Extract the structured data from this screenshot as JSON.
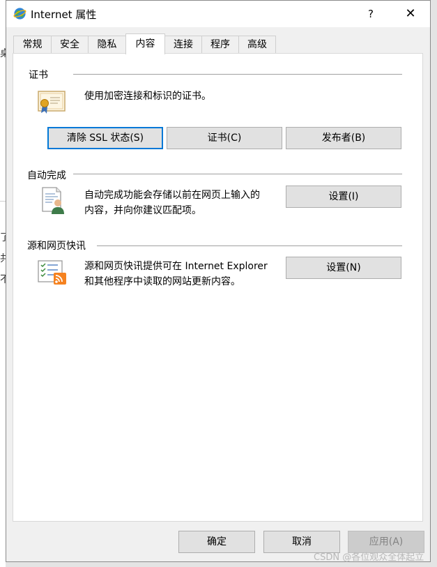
{
  "window": {
    "title": "Internet 属性",
    "help_label": "?",
    "close_label": "✕"
  },
  "background_fragments": [
    "桌",
    "了",
    "共",
    "不"
  ],
  "tabs": [
    {
      "label": "常规"
    },
    {
      "label": "安全"
    },
    {
      "label": "隐私"
    },
    {
      "label": "内容"
    },
    {
      "label": "连接"
    },
    {
      "label": "程序"
    },
    {
      "label": "高级"
    }
  ],
  "active_tab": "内容",
  "certificates": {
    "title": "证书",
    "description": "使用加密连接和标识的证书。",
    "icon": "certificate-icon",
    "buttons": {
      "clear_ssl": "清除 SSL 状态(S)",
      "certificates": "证书(C)",
      "publishers": "发布者(B)"
    }
  },
  "autocomplete": {
    "title": "自动完成",
    "description_line1": "自动完成功能会存储以前在网页上输入的",
    "description_line2": "内容，并向你建议匹配项。",
    "icon": "autocomplete-user-icon",
    "settings_label": "设置(I)"
  },
  "feeds": {
    "title": "源和网页快讯",
    "description_line1": "源和网页快讯提供可在 Internet Explorer",
    "description_line2": "和其他程序中读取的网站更新内容。",
    "icon": "feed-rss-icon",
    "settings_label": "设置(N)"
  },
  "footer": {
    "ok_label": "确定",
    "cancel_label": "取消",
    "apply_label": "应用(A)"
  },
  "watermark": "CSDN @各位观众全体起立",
  "colors": {
    "focus_border": "#0078d7",
    "rss_orange": "#f58220"
  }
}
